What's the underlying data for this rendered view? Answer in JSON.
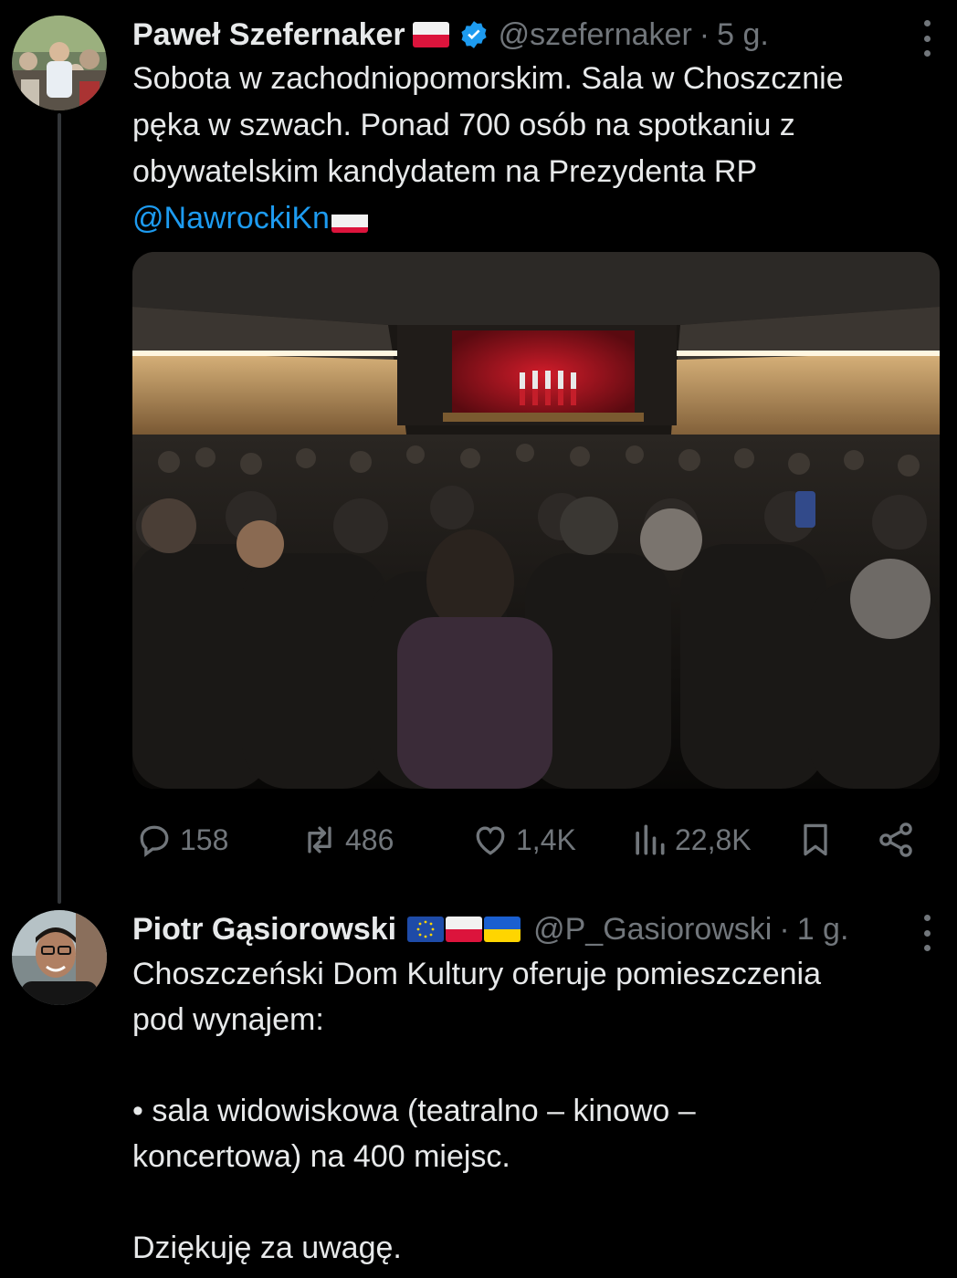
{
  "tweet1": {
    "author_name": "Paweł Szefernaker",
    "handle": "@szefernaker",
    "separator": "·",
    "time": "5 g.",
    "text_lines": [
      "Sobota w zachodniopomorskim. Sala w Choszcznie",
      "pęka w szwach. Ponad 700 osób na spotkaniu z",
      "obywatelskim kandydatem na Prezydenta RP"
    ],
    "mention": "@NawrockiKn",
    "flags": [
      "poland-flag"
    ],
    "verified_icon": "verified-badge-icon",
    "actions": {
      "replies": "158",
      "reposts": "486",
      "likes": "1,4K",
      "views": "22,8K"
    }
  },
  "tweet2": {
    "author_name": "Piotr Gąsiorowski",
    "handle": "@P_Gasiorowski",
    "separator": "·",
    "time": "1 g.",
    "flags": [
      "eu-flag",
      "poland-flag",
      "ukraine-flag"
    ],
    "text_lines": [
      "Choszczeński Dom Kultury oferuje pomieszczenia",
      "pod wynajem:",
      "",
      "• sala widowiskowa (teatralno – kinowo –",
      "koncertowa) na 400 miejsc.",
      "",
      "Dziękuję za uwagę."
    ]
  },
  "colors": {
    "background": "#000000",
    "text": "#e7e9ea",
    "secondary": "#71767b",
    "accent": "#1d9bf0"
  }
}
